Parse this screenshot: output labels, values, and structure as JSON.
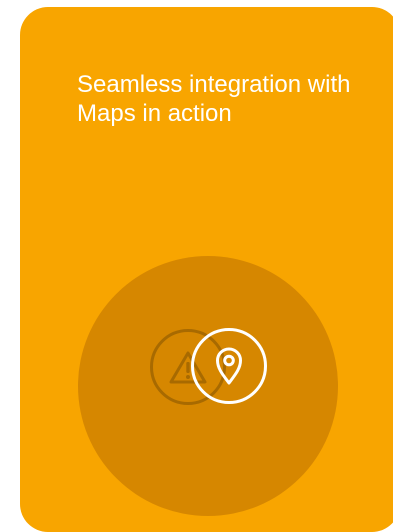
{
  "card": {
    "title": "Seamless integration with Maps in action"
  },
  "colors": {
    "card_background": "#f8a500",
    "circle_background": "#d68700",
    "warning_icon_color": "#a86a00",
    "location_icon_color": "#ffffff"
  },
  "icons": {
    "warning": "warning-icon",
    "location": "location-pin-icon"
  }
}
